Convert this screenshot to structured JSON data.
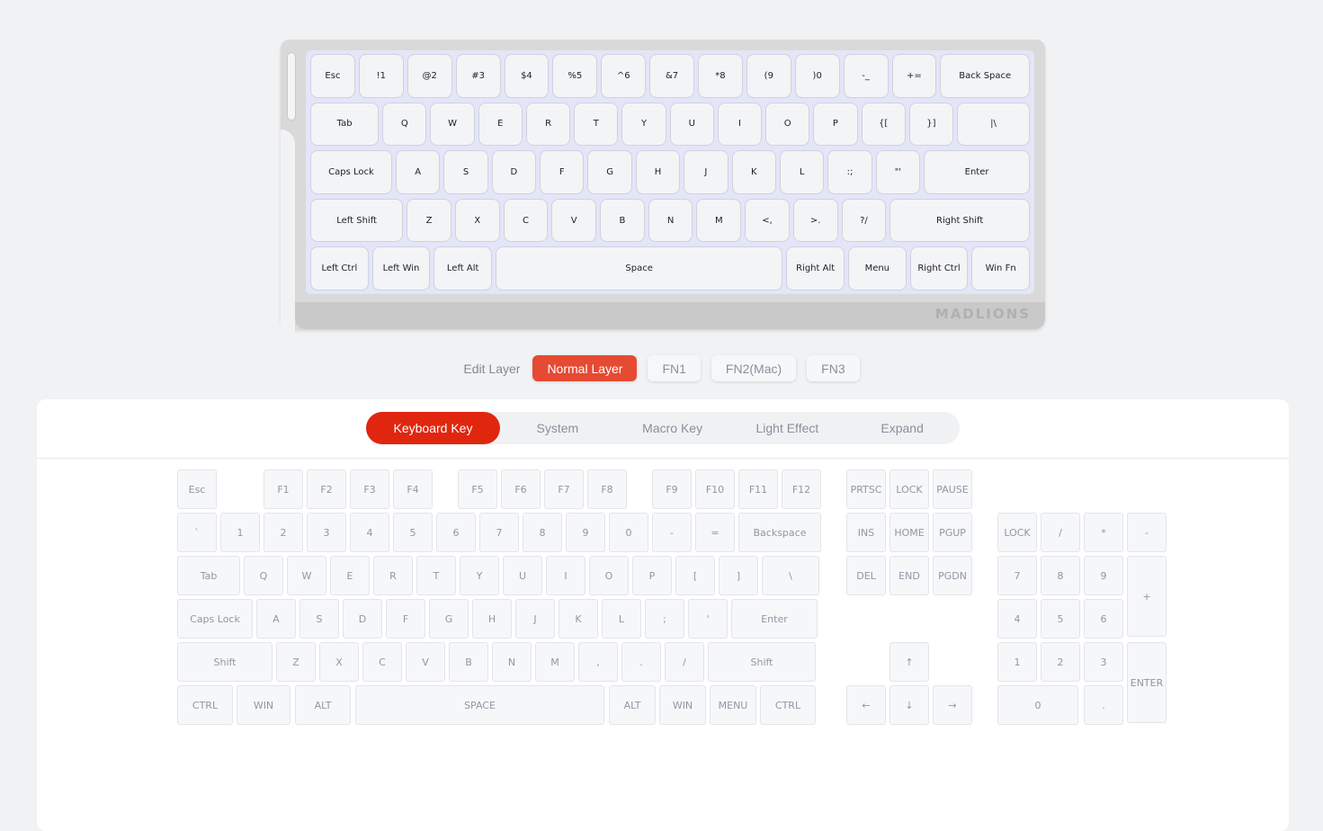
{
  "keyboard_preview": {
    "brand": "MADLIONS",
    "rows": [
      [
        "Esc",
        "!1",
        "@2",
        "#3",
        "$4",
        "%5",
        "^6",
        "&7",
        "*8",
        "(9",
        ")0",
        "-_",
        "+=",
        "Back Space"
      ],
      [
        "Tab",
        "Q",
        "W",
        "E",
        "R",
        "T",
        "Y",
        "U",
        "I",
        "O",
        "P",
        "{[",
        "}]",
        "|\\"
      ],
      [
        "Caps Lock",
        "A",
        "S",
        "D",
        "F",
        "G",
        "H",
        "J",
        "K",
        "L",
        ":;",
        "\"'",
        "Enter"
      ],
      [
        "Left Shift",
        "Z",
        "X",
        "C",
        "V",
        "B",
        "N",
        "M",
        "<,",
        ">.",
        "?/",
        "Right Shift"
      ],
      [
        "Left Ctrl",
        "Left Win",
        "Left Alt",
        "Space",
        "Right Alt",
        "Menu",
        "Right Ctrl",
        "Win Fn"
      ]
    ]
  },
  "layers": {
    "label": "Edit Layer",
    "items": [
      "Normal Layer",
      "FN1",
      "FN2(Mac)",
      "FN3"
    ],
    "active": "Normal Layer"
  },
  "tabs": {
    "items": [
      "Keyboard Key",
      "System",
      "Macro Key",
      "Light Effect",
      "Expand"
    ],
    "active": "Keyboard Key"
  },
  "key_picker": [
    "Esc",
    "F1",
    "F2",
    "F3",
    "F4",
    "F5",
    "F6",
    "F7",
    "F8",
    "F9",
    "F10",
    "F11",
    "F12",
    "PRTSC",
    "LOCK",
    "PAUSE",
    "`",
    "1",
    "2",
    "3",
    "4",
    "5",
    "6",
    "7",
    "8",
    "9",
    "0",
    "-",
    "=",
    "Backspace",
    "INS",
    "HOME",
    "PGUP",
    "LOCK",
    "/",
    "*",
    "-",
    "Tab",
    "Q",
    "W",
    "E",
    "R",
    "T",
    "Y",
    "U",
    "I",
    "O",
    "P",
    "[",
    "]",
    "\\",
    "DEL",
    "END",
    "PGDN",
    "7",
    "8",
    "9",
    "+",
    "Caps Lock",
    "A",
    "S",
    "D",
    "F",
    "G",
    "H",
    "J",
    "K",
    "L",
    ";",
    "'",
    "Enter",
    "4",
    "5",
    "6",
    "Shift",
    "Z",
    "X",
    "C",
    "V",
    "B",
    "N",
    "M",
    ",",
    ".",
    "/",
    "Shift",
    "↑",
    "1",
    "2",
    "3",
    "ENTER",
    "CTRL",
    "WIN",
    "ALT",
    "SPACE",
    "ALT",
    "WIN",
    "MENU",
    "CTRL",
    "←",
    "↓",
    "→",
    "0",
    "."
  ],
  "colors": {
    "accent": "#e0260f",
    "layer_active": "#e64a33",
    "plate": "#e3e6f8"
  }
}
